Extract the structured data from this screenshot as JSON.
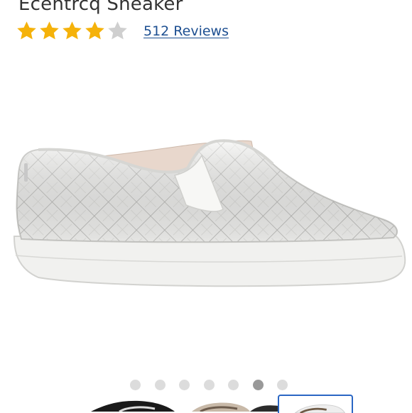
{
  "product": {
    "title": "Ecentrcq Sneaker",
    "rating": 4,
    "max_rating": 5,
    "reviews_label": "512 Reviews"
  },
  "gallery": {
    "image_count": 7,
    "active_index": 5
  },
  "colors": {
    "star_filled": "#f5b20a",
    "star_empty": "#cfcfcf",
    "link": "#1d4f91",
    "dot": "#dcdcdc",
    "dot_active": "#999999",
    "selected_border": "#2a66c4"
  }
}
